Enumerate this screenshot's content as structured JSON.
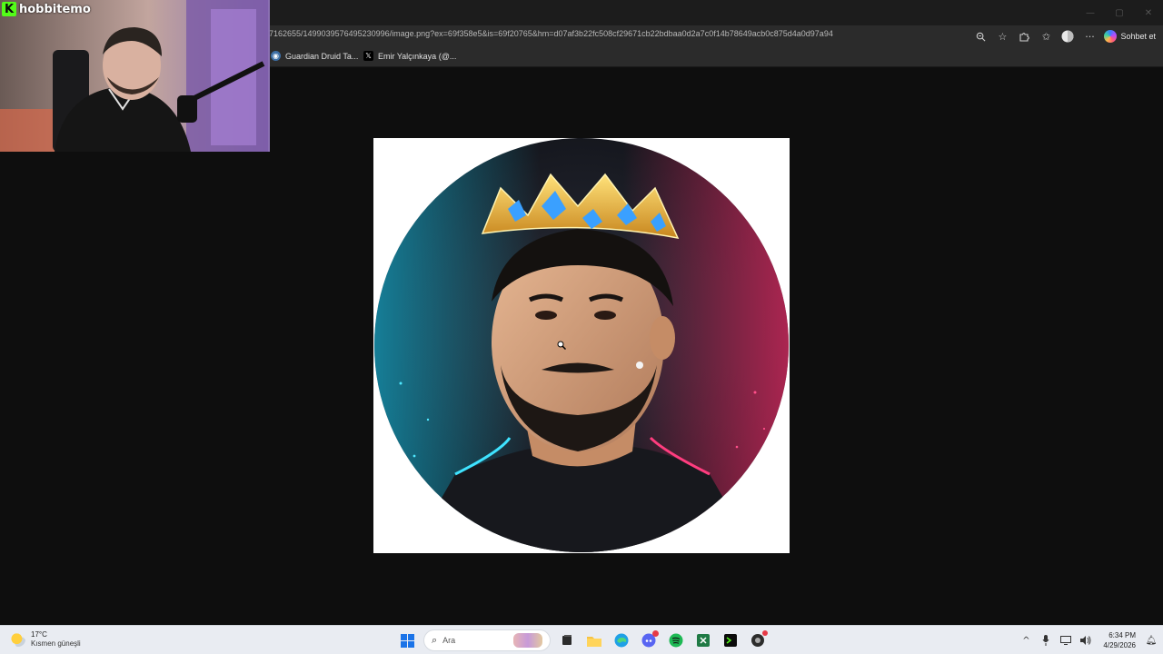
{
  "browser": {
    "url": "7162655/1499039576495230996/image.png?ex=69f358e5&is=69f20765&hm=d07af3b22fc508cf29671cb22bdbaa0d2a7c0f14b78649acb0c875d4a0d97a94",
    "copilot_label": "Sohbet et",
    "window_controls": {
      "minimize": "—",
      "maximize": "▢",
      "close": "✕"
    },
    "bookmarks": [
      {
        "label": "Guardian Druid Ta...",
        "icon": "globe-icon"
      },
      {
        "label": "Emir Yalçınkaya (@...",
        "icon": "x-logo-icon"
      }
    ]
  },
  "webcam": {
    "streamer_name": "hobbitemo",
    "platform_logo_letter": "K",
    "brand_color": "#53fc18"
  },
  "content": {
    "image_subject": "avatar-crowned-man-neon"
  },
  "taskbar": {
    "weather": {
      "temp": "17°C",
      "desc": "Kısmen güneşli"
    },
    "search_placeholder": "Ara",
    "clock": {
      "time": "6:34 PM",
      "date": "4/29/2026"
    },
    "pinned_apps": [
      "start-icon",
      "search-icon",
      "file-manager-icon",
      "explorer-icon",
      "edge-icon",
      "discord-icon",
      "spotify-icon",
      "excel-icon",
      "terminal-icon",
      "app-icon"
    ]
  }
}
